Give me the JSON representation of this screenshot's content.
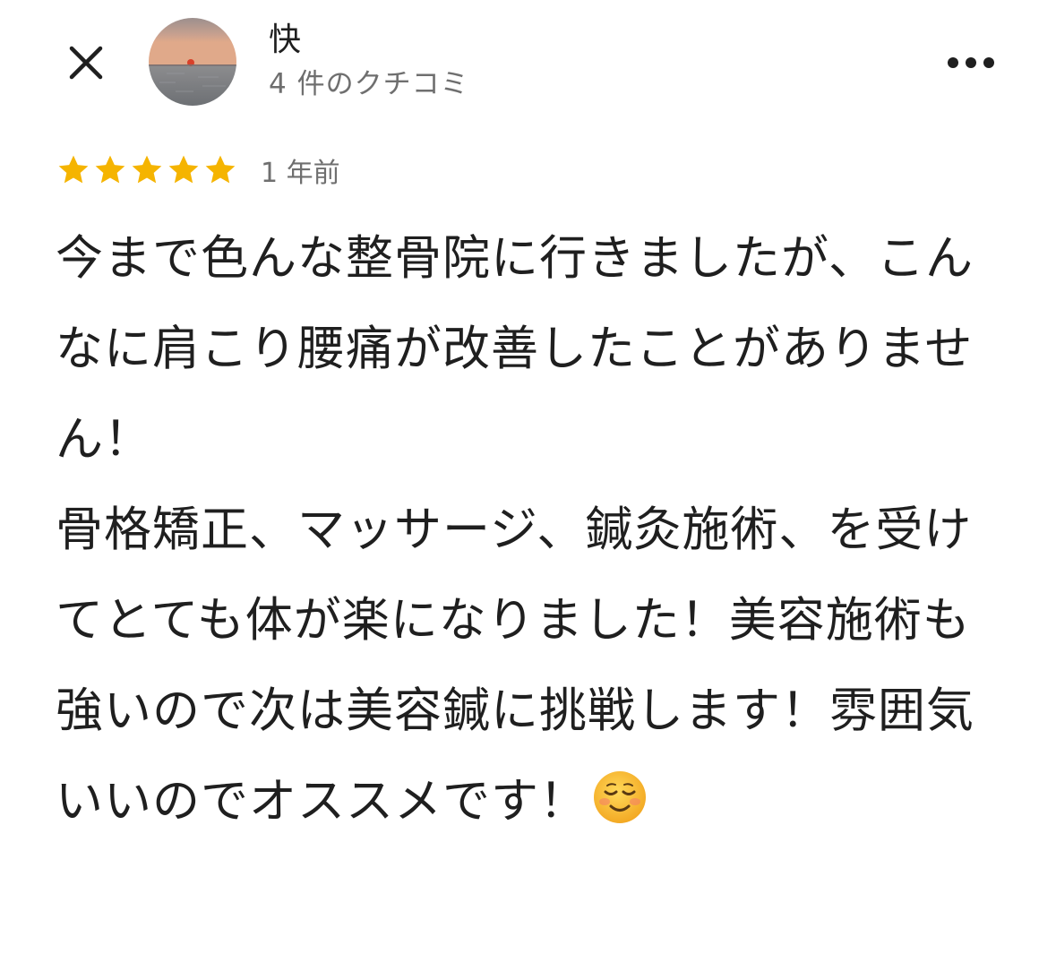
{
  "reviewer": {
    "name": "快",
    "review_count": "4 件のクチコミ",
    "avatar_icon": "sunset-sea-avatar"
  },
  "review": {
    "rating": 5,
    "max_rating": 5,
    "date": "1 年前",
    "text": "今まで色んな整骨院に行きましたが、こんなに肩こり腰痛が改善したことがありません！\n骨格矯正、マッサージ、鍼灸施術、を受けてとても体が楽になりました！美容施術も強いので次は美容鍼に挑戦します！雰囲気いいのでオススメです！",
    "trailing_emoji": "smiling-face-emoji"
  },
  "icons": {
    "close": "close-icon",
    "more": "more-options-icon",
    "star": "star-icon"
  },
  "colors": {
    "star": "#F5B400",
    "text_primary": "#1f1f1f",
    "text_secondary": "#6f6f6f"
  }
}
